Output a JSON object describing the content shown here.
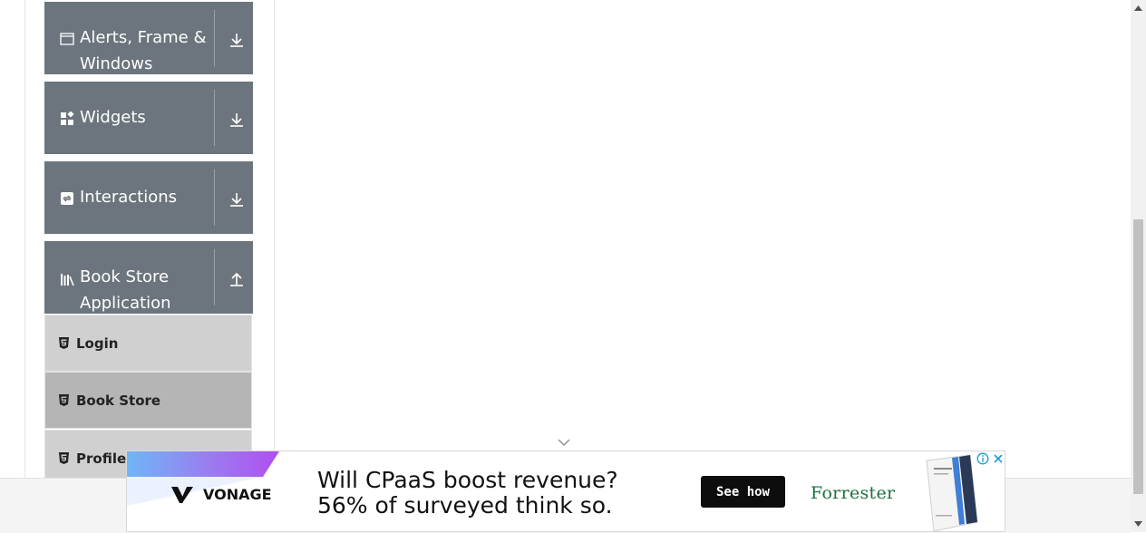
{
  "sidebar": {
    "groups": [
      {
        "title": "Alerts, Frame & Windows",
        "icon": "window-icon",
        "toggle_icon": "download-arrow-icon"
      },
      {
        "title": "Widgets",
        "icon": "widgets-icon",
        "toggle_icon": "download-arrow-icon"
      },
      {
        "title": "Interactions",
        "icon": "interactions-icon",
        "toggle_icon": "download-arrow-icon"
      },
      {
        "title": "Book Store Application",
        "icon": "books-icon",
        "toggle_icon": "upload-arrow-icon"
      }
    ],
    "book_store_items": [
      {
        "label": "Login",
        "icon": "html5-icon",
        "active": false
      },
      {
        "label": "Book Store",
        "icon": "html5-icon",
        "active": true
      },
      {
        "label": "Profile",
        "icon": "html5-icon",
        "active": false
      }
    ]
  },
  "ad": {
    "brand": "VONAGE",
    "headline_line1": "Will CPaaS boost revenue?",
    "headline_line2": "56% of surveyed think so.",
    "cta_label": "See how",
    "partner": "Forrester",
    "icons": [
      "info-icon",
      "close-icon"
    ]
  },
  "colors": {
    "group_bg": "#6c757d",
    "item_bg": "#d0d0d0",
    "item_active_bg": "#b5b5b5",
    "forrester_green": "#1c6f3f",
    "cta_bg": "#0d0d0d"
  }
}
